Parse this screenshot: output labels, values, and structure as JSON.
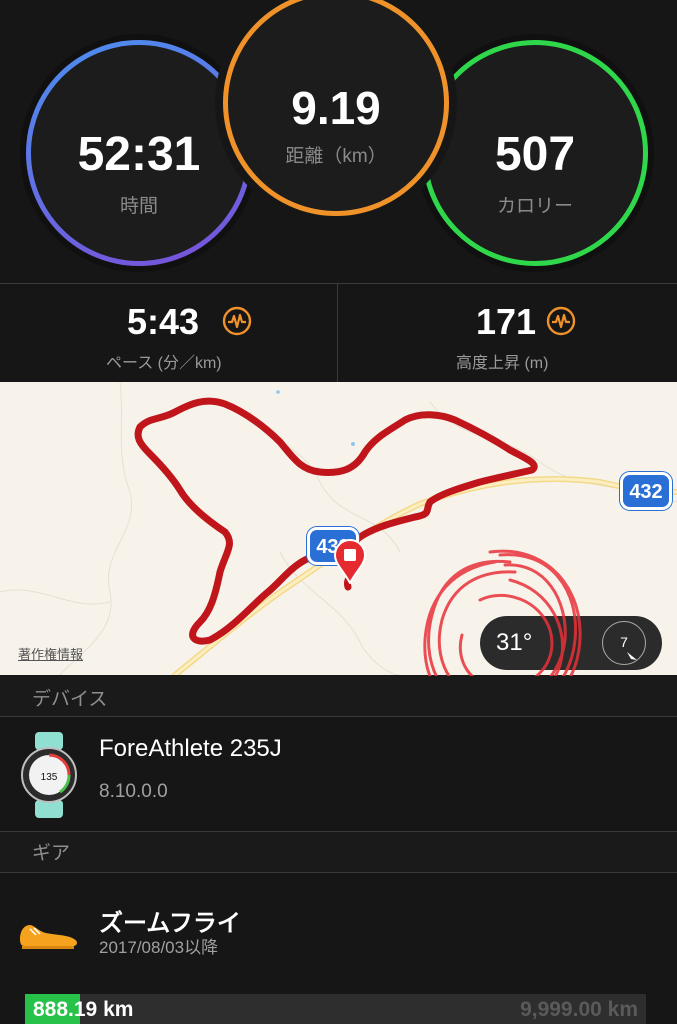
{
  "summary": {
    "time": {
      "value": "52:31",
      "label": "時間"
    },
    "distance": {
      "value": "9.19",
      "label": "距離（km）"
    },
    "calories": {
      "value": "507",
      "label": "カロリー"
    }
  },
  "metrics": {
    "pace": {
      "value": "5:43",
      "label": "ペース (分／km)"
    },
    "elevation": {
      "value": "171",
      "label": "高度上昇 (m)"
    }
  },
  "map": {
    "road_number": "432",
    "road_number_partial": "432",
    "copyright_label": "著作権情報",
    "temperature": "31°",
    "wind_speed": "7"
  },
  "device": {
    "section_title": "デバイス",
    "name": "ForeAthlete 235J",
    "version": "8.10.0.0"
  },
  "gear": {
    "section_title": "ギア",
    "name": "ズームフライ",
    "since": "2017/08/03以降",
    "used_km_whole": "888",
    "used_km_rest": ".19 km",
    "max_km": "9,999.00 km",
    "progress_fraction": 0.0888
  },
  "colors": {
    "time_ring": "#6a6fe0",
    "distance_ring": "#f0922a",
    "calories_ring": "#2fd84a",
    "route": "#c0151b",
    "gear_progress": "#27c24a",
    "icon_orange": "#f0922a"
  }
}
